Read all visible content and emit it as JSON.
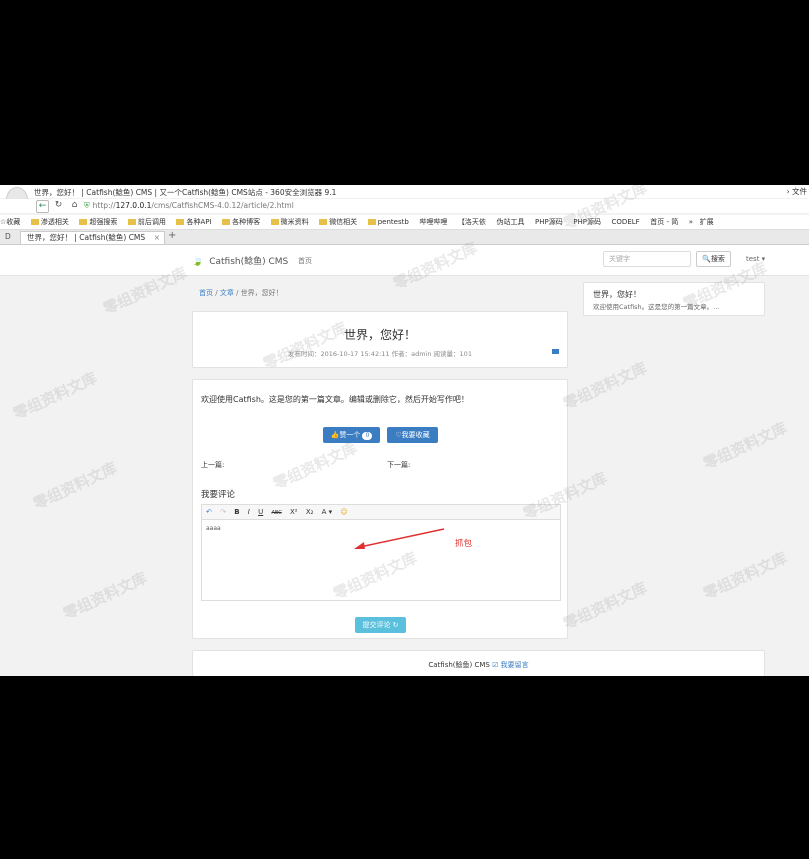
{
  "browser": {
    "window_title": "世界，您好！ | Catfish(鲶鱼) CMS | 又一个Catfish(鲶鱼) CMS站点 - 360安全浏览器 9.1",
    "file_menu": "文件",
    "url_prefix": "http://",
    "url_host": "127.0.0.1",
    "url_path": "/cms/CatfishCMS-4.0.12/article/2.html",
    "bookmarks": [
      "收藏",
      "渗透相关",
      "超强搜索",
      "前后调用",
      "各种API",
      "各种博客",
      "微米资料",
      "微信相关",
      "pentestb",
      "哔哩哔哩",
      "【洛天依",
      "伪站工具",
      "PHP源码",
      "PHP源码",
      "CODELF",
      "首页 - 简",
      "»",
      "扩展"
    ],
    "tab_left_label": "D",
    "tab_label": "世界，您好！ | Catfish(鲶鱼) CMS",
    "tab_close": "×",
    "tab_new": "+"
  },
  "site": {
    "brand": "Catfish(鲶鱼) CMS",
    "nav_home": "首页",
    "search_placeholder": "关键字",
    "search_button": "搜索",
    "user_menu": "test ▾"
  },
  "breadcrumb": {
    "home": "首页",
    "sep1": "/",
    "category": "文章",
    "sep2": "/",
    "current": "世界，您好！"
  },
  "article": {
    "title": "世界，您好！",
    "meta": "发布时间：2016-10-17 15:42:11 作者：admin 阅读量：101",
    "intro": "欢迎使用Catfish。这是您的第一篇文章。编辑或删除它，然后开始写作吧！",
    "like_label": "赞一个",
    "like_count": "0",
    "favorite_label": "我要收藏",
    "prev_label": "上一篇:",
    "next_label": "下一篇:"
  },
  "sidebar": {
    "title": "世界，您好！",
    "desc": "欢迎使用Catfish。这是您的第一篇文章。..."
  },
  "comment": {
    "label": "我要评论",
    "toolbar": [
      "↶",
      "↷",
      "B",
      "I",
      "U",
      "ABC",
      "X²",
      "X₂",
      "A ▾",
      "☺"
    ],
    "editor_text": "aaaa",
    "annotation": "抓包",
    "submit": "提交评论 ↻"
  },
  "footer": {
    "text": "Catfish(鲶鱼) CMS",
    "guestbook": "☑ 我要留言"
  },
  "watermark": "零组资料文库"
}
